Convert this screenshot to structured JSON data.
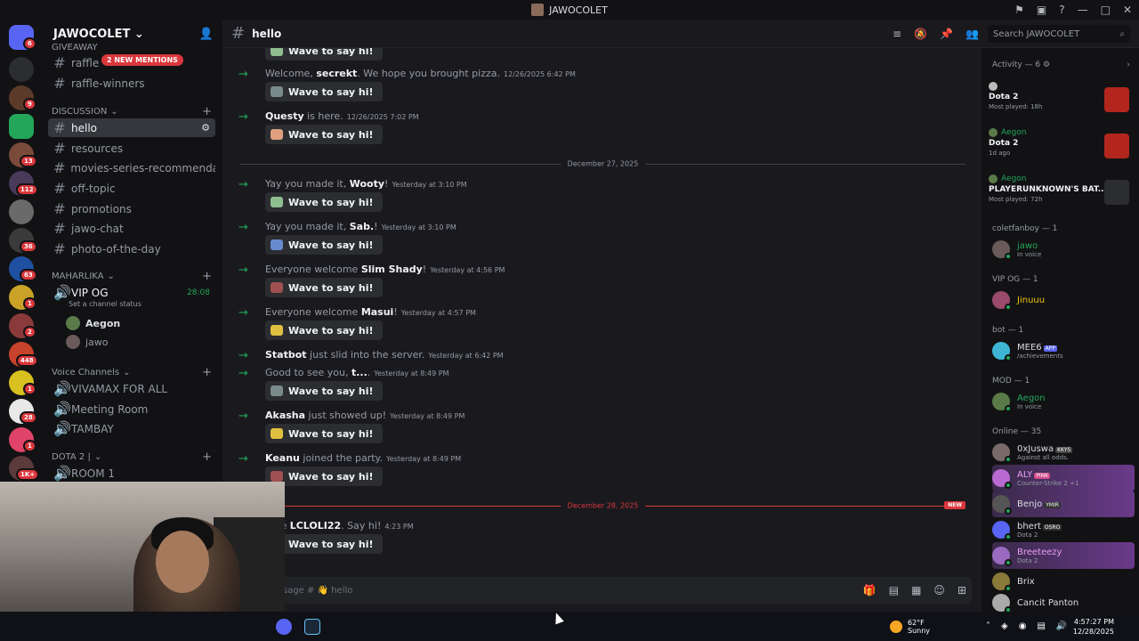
{
  "window": {
    "title": "JAWOCOLET"
  },
  "rail": {
    "badges": [
      "6",
      "9",
      "13",
      "112",
      "36",
      "63",
      "1",
      "2",
      "448",
      "1",
      "28",
      "1",
      "1K+"
    ]
  },
  "sidebar": {
    "guild_name": "JAWOCOLET",
    "mentions_banner": "2 NEW MENTIONS",
    "partial_category": "GIVEAWAY",
    "top_channels": [
      "raffle",
      "raffle-winners"
    ],
    "discussion_label": "DISCUSSION",
    "discussion_channels": [
      "hello",
      "resources",
      "movies-series-recommendations",
      "off-topic",
      "promotions",
      "jawo-chat",
      "photo-of-the-day"
    ],
    "maharlika_label": "MAHARLIKA",
    "vip": {
      "name": "VIP OG",
      "timer": "28:08",
      "status": "Set a channel status",
      "users": [
        "Aegon",
        "jawo"
      ]
    },
    "voice_label": "Voice Channels",
    "voice_channels": [
      "VIVAMAX FOR ALL",
      "Meeting Room",
      "TAMBAY"
    ],
    "dota_label": "DOTA 2 |",
    "dota_channels": [
      "ROOM 1"
    ]
  },
  "header": {
    "channel": "hello",
    "search_placeholder": "Search JAWOCOLET"
  },
  "chat": {
    "wave_label": "Wave to say hi!",
    "messages": [
      {
        "pre": "Welcome, ",
        "name": "secrekt",
        "post": ". We hope you brought pizza.",
        "ts": "12/26/2025 6:42 PM"
      },
      {
        "pre": "",
        "name": "Questy",
        "post": " is here.",
        "ts": "12/26/2025 7:02 PM"
      },
      {
        "pre": "Yay you made it, ",
        "name": "Wooty",
        "post": "!",
        "ts": "Yesterday at 3:10 PM"
      },
      {
        "pre": "Yay you made it, ",
        "name": "Sab.",
        "post": "!",
        "ts": "Yesterday at 3:10 PM"
      },
      {
        "pre": "Everyone welcome ",
        "name": "Slim Shady",
        "post": "!",
        "ts": "Yesterday at 4:56 PM"
      },
      {
        "pre": "Everyone welcome ",
        "name": "Masui",
        "post": "!",
        "ts": "Yesterday at 4:57 PM"
      },
      {
        "pre": "",
        "name": "Statbot",
        "post": " just slid into the server.",
        "ts": "Yesterday at 6:42 PM"
      },
      {
        "pre": "Good to see you, ",
        "name": "t...",
        "post": ".",
        "ts": "Yesterday at 8:49 PM"
      },
      {
        "pre": "",
        "name": "Akasha",
        "post": " just showed up!",
        "ts": "Yesterday at 8:49 PM"
      },
      {
        "pre": "",
        "name": "Keanu",
        "post": " joined the party.",
        "ts": "Yesterday at 8:49 PM"
      },
      {
        "pre": "ome ",
        "name": "LCLOLI22",
        "post": ". Say hi!",
        "ts": "4:23 PM"
      }
    ],
    "date_dividers": [
      "December 27, 2025",
      "December 28, 2025"
    ],
    "new_tag": "NEW",
    "composer_placeholder": "sage # 👋 hello"
  },
  "members": {
    "activity_header": "Activity — 6",
    "activities": [
      {
        "user": "",
        "game": "Dota 2",
        "meta": "Most played: 18h"
      },
      {
        "user": "Aegon",
        "game": "Dota 2",
        "meta": "1d ago"
      },
      {
        "user": "Aegon",
        "game": "PLAYERUNKNOWN'S BAT...",
        "meta": "Most played: 72h"
      }
    ],
    "groups": [
      {
        "label": "coletfanboy — 1"
      },
      {
        "label": "VIP OG — 1"
      },
      {
        "label": "bot — 1"
      },
      {
        "label": "MOD — 1"
      },
      {
        "label": "Online — 35"
      }
    ],
    "list": [
      {
        "name": "jawo",
        "sub": "In voice"
      },
      {
        "name": "Jinuuu",
        "sub": ""
      },
      {
        "name": "MEE6",
        "tag": "APP",
        "sub": "/achievements"
      },
      {
        "name": "Aegon",
        "sub": "In voice"
      },
      {
        "name": "0xJuswa",
        "tag": "KKYS",
        "sub": "Against all odds."
      },
      {
        "name": "ALY",
        "tag": "PINK",
        "sub": "Counter-Strike 2 +1"
      },
      {
        "name": "Benjo",
        "tag": "YMIR",
        "sub": ""
      },
      {
        "name": "bhert",
        "tag": "OSRO",
        "sub": "Dota 2"
      },
      {
        "name": "Breeteezy",
        "sub": "Dota 2"
      },
      {
        "name": "Brix",
        "sub": ""
      },
      {
        "name": "Cancit Panton",
        "sub": ""
      }
    ]
  },
  "taskbar": {
    "temp": "62°F",
    "weather": "Sunny",
    "time": "4:57:27 PM",
    "date": "12/28/2025"
  },
  "colors": {
    "accent": "#5865f2",
    "online": "#23a55a",
    "danger": "#da373c"
  }
}
